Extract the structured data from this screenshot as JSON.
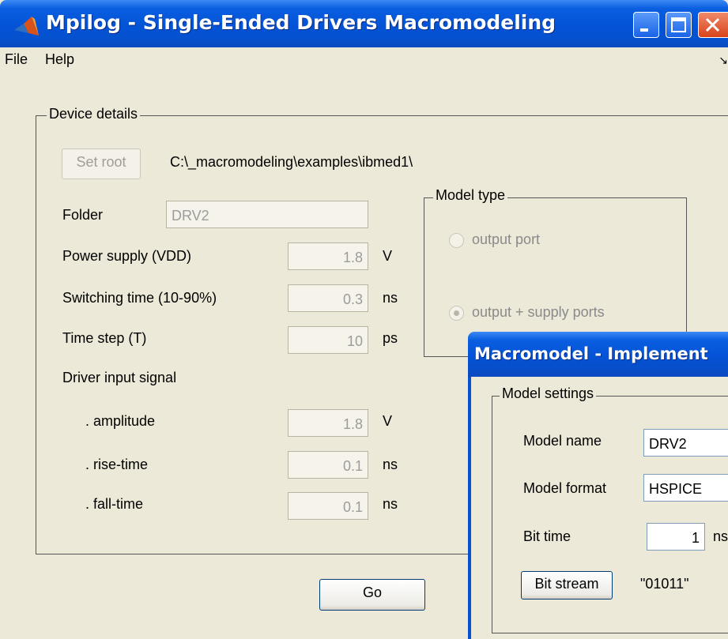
{
  "window": {
    "title": "Mpilog - Single-Ended Drivers Macromodeling",
    "menu": [
      "File",
      "Help"
    ],
    "menu_arrow": "↘"
  },
  "device": {
    "group_title": "Device details",
    "set_root_label": "Set root",
    "root_path": "C:\\_macromodeling\\examples\\ibmed1\\",
    "folder_label": "Folder",
    "folder_value": "DRV2",
    "vdd_label": "Power supply (VDD)",
    "vdd_value": "1.8",
    "vdd_unit": "V",
    "switch_label": "Switching time (10-90%)",
    "switch_value": "0.3",
    "switch_unit": "ns",
    "tstep_label": "Time step (T)",
    "tstep_value": "10",
    "tstep_unit": "ps",
    "input_signal_label": "Driver input signal",
    "amp_label": ". amplitude",
    "amp_value": "1.8",
    "amp_unit": "V",
    "rise_label": ". rise-time",
    "rise_value": "0.1",
    "rise_unit": "ns",
    "fall_label": ". fall-time",
    "fall_value": "0.1",
    "fall_unit": "ns"
  },
  "model_type": {
    "group_title": "Model type",
    "option_output": "output port",
    "option_output_supply": "output + supply ports",
    "selected": "output + supply ports"
  },
  "go_label": "Go",
  "dialog": {
    "title": "Macromodel - Implement",
    "group_title": "Model settings",
    "name_label": "Model name",
    "name_value": "DRV2",
    "format_label": "Model format",
    "format_value": "HSPICE",
    "bit_time_label": "Bit time",
    "bit_time_value": "1",
    "bit_time_unit": "ns",
    "bit_stream_button": "Bit stream",
    "bit_stream_value": "\"01011\""
  },
  "colors": {
    "titlebar": "#0552cf",
    "window_bg": "#ece9d8",
    "close_button": "#d8431a"
  }
}
